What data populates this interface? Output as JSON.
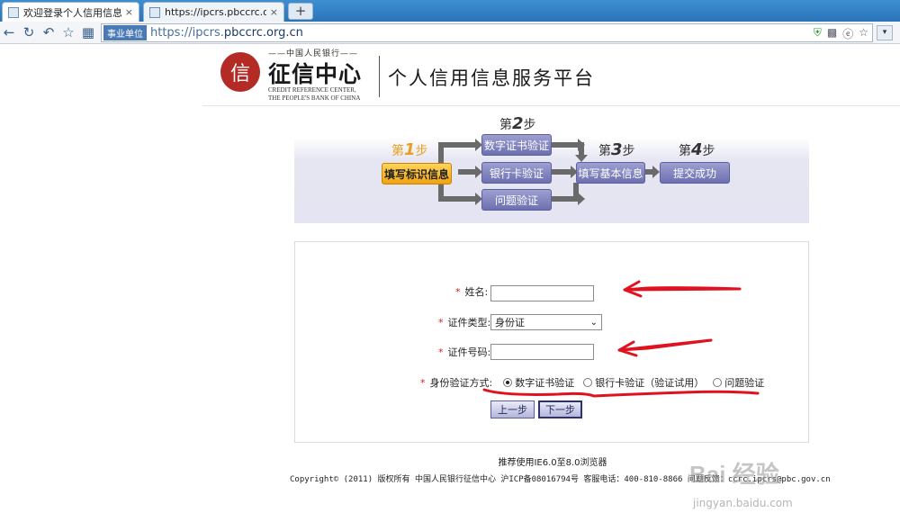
{
  "browser": {
    "tabs": [
      {
        "label": "欢迎登录个人信用信息服务",
        "close": "×"
      },
      {
        "label": "https://ipcrs.pbccrc.org.c",
        "close": "×"
      }
    ],
    "new_tab": "+",
    "address": {
      "badge": "事业单位",
      "scheme": "https://ipcrs.",
      "domain": "pbccrc.org.cn"
    }
  },
  "header": {
    "seal_glyph": "信",
    "top_text": "——中国人民银行——",
    "title": "征信中心",
    "en_line1": "CREDIT REFERENCE CENTER,",
    "en_line2": "THE PEOPLE'S BANK OF CHINA",
    "platform": "个人信用信息服务平台"
  },
  "steps": {
    "step1": {
      "prefix": "第",
      "num": "1",
      "suffix": "步"
    },
    "step2": {
      "prefix": "第",
      "num": "2",
      "suffix": "步"
    },
    "step3": {
      "prefix": "第",
      "num": "3",
      "suffix": "步"
    },
    "step4": {
      "prefix": "第",
      "num": "4",
      "suffix": "步"
    },
    "fill_identity": "填写标识信息",
    "digital_cert": "数字证书验证",
    "bank_card": "银行卡验证",
    "question": "问题验证",
    "fill_basic": "填写基本信息",
    "submit_success": "提交成功"
  },
  "form": {
    "required_mark": "*",
    "name_label": "姓名:",
    "name_value": "",
    "id_type_label": "证件类型:",
    "id_type_value": "身份证",
    "id_number_label": "证件号码:",
    "id_number_value": "",
    "verify_label": "身份验证方式:",
    "options": [
      {
        "label": "数字证书验证",
        "selected": true
      },
      {
        "label": "银行卡验证（验证试用）",
        "selected": false
      },
      {
        "label": "问题验证",
        "selected": false
      }
    ],
    "prev_button": "上一步",
    "next_button": "下一步"
  },
  "footer": {
    "recommend": "推荐使用IE6.0至8.0浏览器",
    "copyright": "Copyright© (2011) 版权所有 中国人民银行征信中心 沪ICP备08016794号 客服电话：400-810-8866 问题反馈：ccrc.ipcrs@pbc.gov.cn"
  },
  "watermark": {
    "logo": "Bai 经验",
    "url": "jingyan.baidu.com"
  },
  "colors": {
    "annotation": "#e0121f",
    "step_active": "#f5b320",
    "step_box": "#7d80bd",
    "required": "#d21f1f"
  }
}
